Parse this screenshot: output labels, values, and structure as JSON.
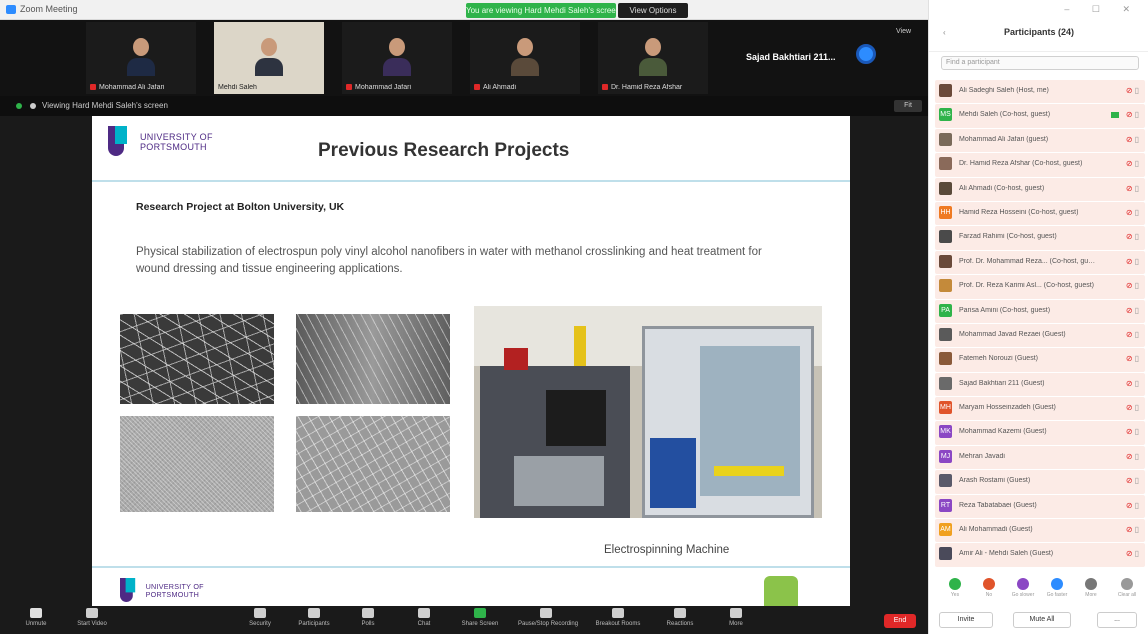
{
  "window": {
    "title": "Zoom Meeting",
    "share_banner": "You are viewing Hard Mehdi Saleh's screen",
    "view_options": "View Options"
  },
  "gallery": {
    "tiles": [
      {
        "name": "Mohammad Ali Jafari",
        "muted": true,
        "speaking": false,
        "body_color": "#1e2a44"
      },
      {
        "name": "Mehdi Saleh",
        "muted": false,
        "speaking": true,
        "body_color": "#2d3340"
      },
      {
        "name": "Mohammad Jafari",
        "muted": true,
        "speaking": false,
        "body_color": "#3a2d5a"
      },
      {
        "name": "Ali Ahmadi",
        "muted": true,
        "speaking": false,
        "body_color": "#5a4a3a"
      },
      {
        "name": "Dr. Hamid Reza Afshar",
        "muted": true,
        "speaking": false,
        "body_color": "#4a5a3a"
      }
    ],
    "more_label": "Sajad Bakhtiari 211...",
    "view_label": "View"
  },
  "share": {
    "viewing_label": "Viewing Hard Mehdi Saleh's screen",
    "fit_label": "Fit"
  },
  "slide": {
    "logo_text_line1": "UNIVERSITY OF",
    "logo_text_line2": "PORTSMOUTH",
    "title": "Previous Research Projects",
    "project_heading": "Research Project at Bolton University, UK",
    "project_desc": "Physical stabilization of electrospun poly vinyl alcohol nanofibers in water with methanol crosslinking and heat treatment for wound dressing and tissue engineering applications.",
    "machine_caption": "Electrospinning Machine"
  },
  "controls": {
    "buttons": [
      {
        "label": "Unmute",
        "icon": "microphone-icon"
      },
      {
        "label": "Start Video",
        "icon": "video-camera-icon"
      },
      {
        "label": "Security",
        "icon": "shield-icon"
      },
      {
        "label": "Participants",
        "icon": "participants-icon"
      },
      {
        "label": "Polls",
        "icon": "polls-icon"
      },
      {
        "label": "Chat",
        "icon": "chat-icon"
      },
      {
        "label": "Share Screen",
        "icon": "share-screen-icon"
      },
      {
        "label": "Pause/Stop Recording",
        "icon": "record-icon"
      },
      {
        "label": "Breakout Rooms",
        "icon": "breakout-rooms-icon"
      },
      {
        "label": "Reactions",
        "icon": "reactions-icon"
      },
      {
        "label": "More",
        "icon": "more-icon"
      }
    ],
    "end_label": "End"
  },
  "panel": {
    "title": "Participants (24)",
    "search_placeholder": "Find a participant",
    "participants": [
      {
        "name": "Ali Sadeghi Saleh (Host, me)",
        "avatar": "photo",
        "avatar_color": "#6b4a3a",
        "video": false
      },
      {
        "name": "Mehdi Saleh (Co-host, guest)",
        "avatar": "MS",
        "avatar_color": "#2fb34a",
        "video": true
      },
      {
        "name": "Mohammad Ali Jafari (guest)",
        "avatar": "photo",
        "avatar_color": "#7a6a5a",
        "video": false
      },
      {
        "name": "Dr. Hamid Reza Afshar (Co-host, guest)",
        "avatar": "photo",
        "avatar_color": "#8a6a5a",
        "video": false
      },
      {
        "name": "Ali Ahmadi (Co-host, guest)",
        "avatar": "photo",
        "avatar_color": "#5a4a3a",
        "video": false
      },
      {
        "name": "Hamid Reza Hosseini (Co-host, guest)",
        "avatar": "HH",
        "avatar_color": "#ef7a22",
        "video": false
      },
      {
        "name": "Farzad Rahimi (Co-host, guest)",
        "avatar": "photo",
        "avatar_color": "#4a4a4a",
        "video": false
      },
      {
        "name": "Prof. Dr. Mohammad Reza... (Co-host, guest)",
        "avatar": "photo",
        "avatar_color": "#6a4a3a",
        "video": false
      },
      {
        "name": "Prof. Dr. Reza Karimi Asl... (Co-host, guest)",
        "avatar": "photo",
        "avatar_color": "#c48a3a",
        "video": false
      },
      {
        "name": "Parisa Amini (Co-host, guest)",
        "avatar": "PA",
        "avatar_color": "#2fb34a",
        "video": false
      },
      {
        "name": "Mohammad Javad Rezaei (Guest)",
        "avatar": "photo",
        "avatar_color": "#5a5a5a",
        "video": false
      },
      {
        "name": "Fatemeh Norouzi (Guest)",
        "avatar": "photo",
        "avatar_color": "#8a5a3a",
        "video": false
      },
      {
        "name": "Sajad Bakhtiari 211 (Guest)",
        "avatar": "photo",
        "avatar_color": "#6a6a6a",
        "video": false
      },
      {
        "name": "Maryam Hosseinzadeh (Guest)",
        "avatar": "MH",
        "avatar_color": "#e0542b",
        "video": false
      },
      {
        "name": "Mohammad Kazemi (Guest)",
        "avatar": "MK",
        "avatar_color": "#8b47c4",
        "video": false
      },
      {
        "name": "Mehran Javadi",
        "avatar": "MJ",
        "avatar_color": "#8b47c4",
        "video": false
      },
      {
        "name": "Arash Rostami (Guest)",
        "avatar": "photo",
        "avatar_color": "#5a5a6a",
        "video": false
      },
      {
        "name": "Reza Tabatabaei (Guest)",
        "avatar": "RT",
        "avatar_color": "#8b47c4",
        "video": false
      },
      {
        "name": "Ali Mohammadi (Guest)",
        "avatar": "AM",
        "avatar_color": "#f0a020",
        "video": false
      },
      {
        "name": "Amir Ali - Mehdi Saleh (Guest)",
        "avatar": "photo",
        "avatar_color": "#4a4a5a",
        "video": false
      }
    ],
    "reactions": [
      {
        "label": "Yes",
        "color": "#2fb34a"
      },
      {
        "label": "No",
        "color": "#e0542b"
      },
      {
        "label": "Go slower",
        "color": "#8b47c4"
      },
      {
        "label": "Go faster",
        "color": "#2d8cff"
      },
      {
        "label": "More",
        "color": "#777777"
      },
      {
        "label": "Clear all",
        "color": "#999999"
      }
    ],
    "invite_label": "Invite",
    "mute_all_label": "Mute All",
    "more_label": "..."
  }
}
